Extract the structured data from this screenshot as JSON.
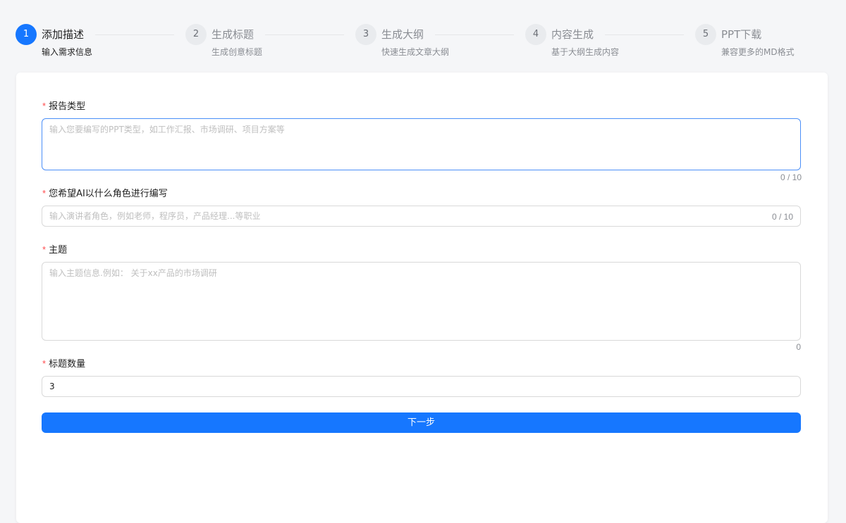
{
  "steps": [
    {
      "number": "1",
      "title": "添加描述",
      "desc": "输入需求信息",
      "active": true
    },
    {
      "number": "2",
      "title": "生成标题",
      "desc": "生成创意标题",
      "active": false
    },
    {
      "number": "3",
      "title": "生成大纲",
      "desc": "快速生成文章大纲",
      "active": false
    },
    {
      "number": "4",
      "title": "内容生成",
      "desc": "基于大纲生成内容",
      "active": false
    },
    {
      "number": "5",
      "title": "PPT下载",
      "desc": "兼容更多的MD格式",
      "active": false
    }
  ],
  "form": {
    "required_mark": "*",
    "report_type": {
      "label": "报告类型",
      "placeholder": "输入您要编写的PPT类型，如工作汇报、市场调研、项目方案等",
      "value": "",
      "counter": "0 / 10"
    },
    "role": {
      "label": "您希望AI以什么角色进行编写",
      "placeholder": "输入演讲者角色，例如老师，程序员，产品经理...等职业",
      "value": "",
      "counter": "0 / 10"
    },
    "topic": {
      "label": "主题",
      "placeholder": "输入主题信息.例如： 关于xx产品的市场调研",
      "value": "",
      "counter": "0"
    },
    "title_count": {
      "label": "标题数量",
      "value": "3"
    },
    "next_button": "下一步"
  },
  "colors": {
    "accent": "#1677ff",
    "required": "#ff4d4f",
    "focus_border": "#4b8ff8"
  }
}
